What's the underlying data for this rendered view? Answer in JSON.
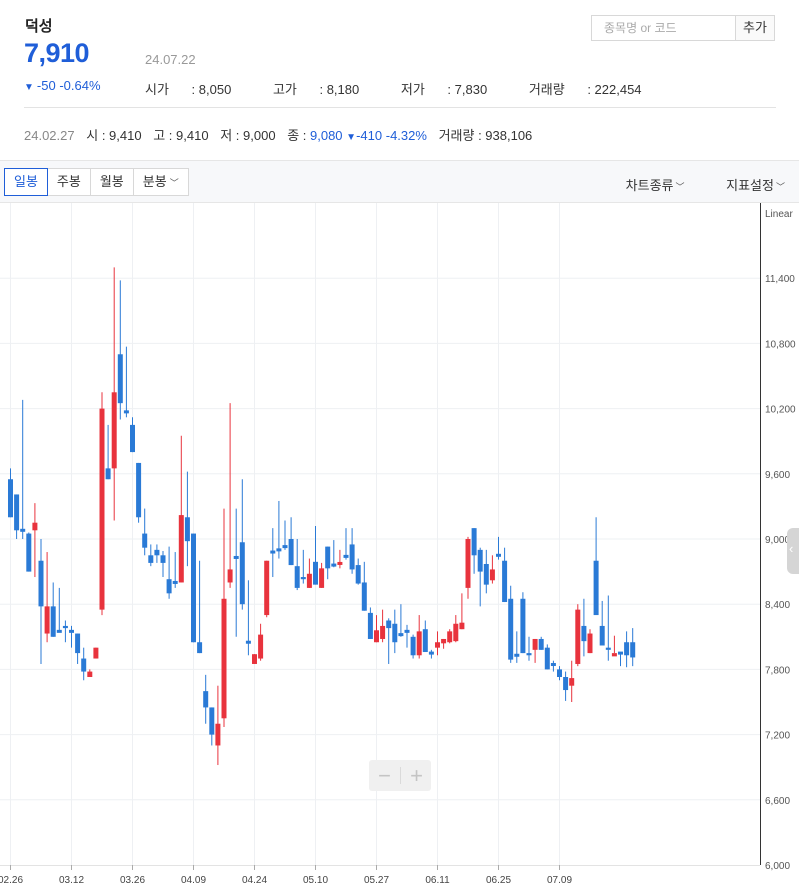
{
  "header": {
    "name": "덕성",
    "price": "7,910",
    "date": "24.07.22",
    "change": "-50",
    "change_pct": "-0.64%",
    "open": "8,050",
    "high": "8,180",
    "low": "7,830",
    "volume": "222,454",
    "labels": {
      "open": "시가",
      "high": "고가",
      "low": "저가",
      "volume": "거래량"
    }
  },
  "search": {
    "placeholder": "종목명 or 코드",
    "add_label": "추가"
  },
  "hover": {
    "date": "24.02.27",
    "labels": {
      "open": "시",
      "high": "고",
      "low": "저",
      "close": "종",
      "volume": "거래량"
    },
    "open": "9,410",
    "high": "9,410",
    "low": "9,000",
    "close": "9,080",
    "change": "-410",
    "change_pct": "-4.32%",
    "volume": "938,106"
  },
  "toolbar": {
    "tabs": [
      "일봉",
      "주봉",
      "월봉",
      "분봉"
    ],
    "active_tab": "일봉",
    "chart_type_label": "차트종류",
    "indicator_label": "지표설정"
  },
  "colors": {
    "up": "#e8333d",
    "down": "#2a7ad6",
    "accent": "#1f5ed8"
  },
  "chart_data": {
    "type": "candlestick",
    "scale": "Linear",
    "ylim": [
      6000,
      11800
    ],
    "y_ticks": [
      "11,400",
      "10,800",
      "10,200",
      "9,600",
      "9,000",
      "8,400",
      "7,800",
      "7,200",
      "6,600",
      "6,000"
    ],
    "x_ticks": [
      "02.26",
      "03.12",
      "03.26",
      "04.09",
      "04.24",
      "05.10",
      "05.27",
      "06.11",
      "06.25",
      "07.09"
    ],
    "candles": [
      {
        "o": 9550,
        "h": 9650,
        "l": 9200,
        "c": 9200
      },
      {
        "o": 9410,
        "h": 9410,
        "l": 9000,
        "c": 9080
      },
      {
        "o": 9080,
        "h": 10280,
        "l": 9000,
        "c": 9080
      },
      {
        "o": 9050,
        "h": 9060,
        "l": 8700,
        "c": 8700
      },
      {
        "o": 9080,
        "h": 9330,
        "l": 8650,
        "c": 9150
      },
      {
        "o": 8800,
        "h": 9000,
        "l": 7850,
        "c": 8380
      },
      {
        "o": 8130,
        "h": 8880,
        "l": 8050,
        "c": 8380
      },
      {
        "o": 8380,
        "h": 8600,
        "l": 8100,
        "c": 8100
      },
      {
        "o": 8150,
        "h": 8550,
        "l": 8150,
        "c": 8150
      },
      {
        "o": 8200,
        "h": 8250,
        "l": 8050,
        "c": 8180
      },
      {
        "o": 8150,
        "h": 8200,
        "l": 8000,
        "c": 8150
      },
      {
        "o": 8130,
        "h": 8130,
        "l": 7850,
        "c": 7950
      },
      {
        "o": 7900,
        "h": 8000,
        "l": 7700,
        "c": 7780
      },
      {
        "o": 7730,
        "h": 7800,
        "l": 7730,
        "c": 7780
      },
      {
        "o": 7900,
        "h": 8000,
        "l": 7900,
        "c": 8000
      },
      {
        "o": 8350,
        "h": 10350,
        "l": 8300,
        "c": 10200
      },
      {
        "o": 9650,
        "h": 10050,
        "l": 9550,
        "c": 9550
      },
      {
        "o": 9650,
        "h": 11500,
        "l": 9170,
        "c": 10350
      },
      {
        "o": 10700,
        "h": 11380,
        "l": 10100,
        "c": 10250
      },
      {
        "o": 10170,
        "h": 10770,
        "l": 10120,
        "c": 10170
      },
      {
        "o": 10050,
        "h": 10120,
        "l": 9800,
        "c": 9800
      },
      {
        "o": 9700,
        "h": 9700,
        "l": 9150,
        "c": 9200
      },
      {
        "o": 9050,
        "h": 9280,
        "l": 8850,
        "c": 8920
      },
      {
        "o": 8850,
        "h": 8950,
        "l": 8750,
        "c": 8780
      },
      {
        "o": 8900,
        "h": 8950,
        "l": 8780,
        "c": 8850
      },
      {
        "o": 8850,
        "h": 8890,
        "l": 8650,
        "c": 8780
      },
      {
        "o": 8630,
        "h": 8930,
        "l": 8450,
        "c": 8500
      },
      {
        "o": 8600,
        "h": 8880,
        "l": 8550,
        "c": 8600
      },
      {
        "o": 8600,
        "h": 9950,
        "l": 8600,
        "c": 9220
      },
      {
        "o": 9200,
        "h": 9620,
        "l": 8750,
        "c": 8980
      },
      {
        "o": 9050,
        "h": 9050,
        "l": 8050,
        "c": 8050
      },
      {
        "o": 8050,
        "h": 8800,
        "l": 7950,
        "c": 7950
      },
      {
        "o": 7600,
        "h": 7750,
        "l": 7300,
        "c": 7450
      },
      {
        "o": 7450,
        "h": 7450,
        "l": 7100,
        "c": 7200
      },
      {
        "o": 7100,
        "h": 7650,
        "l": 6920,
        "c": 7300
      },
      {
        "o": 7350,
        "h": 9280,
        "l": 7270,
        "c": 8450
      },
      {
        "o": 8600,
        "h": 10250,
        "l": 8550,
        "c": 8720
      },
      {
        "o": 8830,
        "h": 9280,
        "l": 8100,
        "c": 8830
      },
      {
        "o": 8970,
        "h": 9550,
        "l": 8350,
        "c": 8400
      },
      {
        "o": 8050,
        "h": 8620,
        "l": 7930,
        "c": 8050
      },
      {
        "o": 7850,
        "h": 7940,
        "l": 7850,
        "c": 7940
      },
      {
        "o": 7900,
        "h": 8220,
        "l": 7880,
        "c": 8120
      },
      {
        "o": 8300,
        "h": 8800,
        "l": 8280,
        "c": 8800
      },
      {
        "o": 8880,
        "h": 9100,
        "l": 8650,
        "c": 8880
      },
      {
        "o": 8900,
        "h": 9350,
        "l": 8820,
        "c": 8900
      },
      {
        "o": 8930,
        "h": 9170,
        "l": 8900,
        "c": 8930
      },
      {
        "o": 9000,
        "h": 9200,
        "l": 8760,
        "c": 8760
      },
      {
        "o": 8750,
        "h": 9000,
        "l": 8530,
        "c": 8550
      },
      {
        "o": 8650,
        "h": 8900,
        "l": 8590,
        "c": 8630
      },
      {
        "o": 8550,
        "h": 8820,
        "l": 8550,
        "c": 8680
      },
      {
        "o": 8790,
        "h": 9120,
        "l": 8580,
        "c": 8580
      },
      {
        "o": 8550,
        "h": 8780,
        "l": 8550,
        "c": 8730
      },
      {
        "o": 8930,
        "h": 8930,
        "l": 8630,
        "c": 8730
      },
      {
        "o": 8760,
        "h": 8990,
        "l": 8740,
        "c": 8760
      },
      {
        "o": 8770,
        "h": 8900,
        "l": 8730,
        "c": 8780
      },
      {
        "o": 8840,
        "h": 9100,
        "l": 8810,
        "c": 8840
      },
      {
        "o": 8950,
        "h": 9100,
        "l": 8680,
        "c": 8720
      },
      {
        "o": 8760,
        "h": 8820,
        "l": 8580,
        "c": 8590
      },
      {
        "o": 8600,
        "h": 8790,
        "l": 8340,
        "c": 8340
      },
      {
        "o": 8320,
        "h": 8370,
        "l": 8080,
        "c": 8080
      },
      {
        "o": 8050,
        "h": 8300,
        "l": 8050,
        "c": 8160
      },
      {
        "o": 8080,
        "h": 8350,
        "l": 8050,
        "c": 8200
      },
      {
        "o": 8250,
        "h": 8270,
        "l": 7850,
        "c": 8180
      },
      {
        "o": 8220,
        "h": 8350,
        "l": 7950,
        "c": 8050
      },
      {
        "o": 8120,
        "h": 8400,
        "l": 8100,
        "c": 8120
      },
      {
        "o": 8150,
        "h": 8210,
        "l": 8000,
        "c": 8150
      },
      {
        "o": 8100,
        "h": 8120,
        "l": 7900,
        "c": 7930
      },
      {
        "o": 7930,
        "h": 8300,
        "l": 7900,
        "c": 8150
      },
      {
        "o": 8170,
        "h": 8250,
        "l": 7960,
        "c": 7960
      },
      {
        "o": 7950,
        "h": 7980,
        "l": 7900,
        "c": 7950
      },
      {
        "o": 8000,
        "h": 8150,
        "l": 7930,
        "c": 8050
      },
      {
        "o": 8040,
        "h": 8080,
        "l": 7990,
        "c": 8080
      },
      {
        "o": 8050,
        "h": 8170,
        "l": 8040,
        "c": 8150
      },
      {
        "o": 8060,
        "h": 8300,
        "l": 8050,
        "c": 8220
      },
      {
        "o": 8170,
        "h": 8500,
        "l": 8170,
        "c": 8230
      },
      {
        "o": 8550,
        "h": 9020,
        "l": 8450,
        "c": 9000
      },
      {
        "o": 9100,
        "h": 9100,
        "l": 8680,
        "c": 8850
      },
      {
        "o": 8900,
        "h": 8920,
        "l": 8380,
        "c": 8700
      },
      {
        "o": 8770,
        "h": 8900,
        "l": 8500,
        "c": 8580
      },
      {
        "o": 8620,
        "h": 8850,
        "l": 8590,
        "c": 8720
      },
      {
        "o": 8850,
        "h": 9020,
        "l": 8810,
        "c": 8850
      },
      {
        "o": 8800,
        "h": 8920,
        "l": 8420,
        "c": 8420
      },
      {
        "o": 8450,
        "h": 8570,
        "l": 7860,
        "c": 7890
      },
      {
        "o": 7930,
        "h": 8150,
        "l": 7860,
        "c": 7930
      },
      {
        "o": 8450,
        "h": 8510,
        "l": 7950,
        "c": 7950
      },
      {
        "o": 7950,
        "h": 8100,
        "l": 7880,
        "c": 7930
      },
      {
        "o": 7980,
        "h": 8080,
        "l": 7860,
        "c": 8080
      },
      {
        "o": 8080,
        "h": 8100,
        "l": 7980,
        "c": 7980
      },
      {
        "o": 8000,
        "h": 8030,
        "l": 7800,
        "c": 7800
      },
      {
        "o": 7850,
        "h": 7880,
        "l": 7780,
        "c": 7840
      },
      {
        "o": 7800,
        "h": 7830,
        "l": 7700,
        "c": 7730
      },
      {
        "o": 7730,
        "h": 7780,
        "l": 7510,
        "c": 7610
      },
      {
        "o": 7650,
        "h": 7880,
        "l": 7500,
        "c": 7720
      },
      {
        "o": 7850,
        "h": 8400,
        "l": 7830,
        "c": 8350
      },
      {
        "o": 8200,
        "h": 8450,
        "l": 7920,
        "c": 8060
      },
      {
        "o": 7950,
        "h": 8170,
        "l": 7950,
        "c": 8130
      },
      {
        "o": 8800,
        "h": 9200,
        "l": 8330,
        "c": 8300
      },
      {
        "o": 8200,
        "h": 8430,
        "l": 8020,
        "c": 8020
      },
      {
        "o": 8000,
        "h": 8480,
        "l": 7880,
        "c": 7980
      },
      {
        "o": 7920,
        "h": 8110,
        "l": 7950,
        "c": 7950
      },
      {
        "o": 7950,
        "h": 7960,
        "l": 7830,
        "c": 7950
      },
      {
        "o": 8050,
        "h": 8150,
        "l": 7820,
        "c": 7930
      },
      {
        "o": 8050,
        "h": 8180,
        "l": 7830,
        "c": 7910
      }
    ]
  }
}
